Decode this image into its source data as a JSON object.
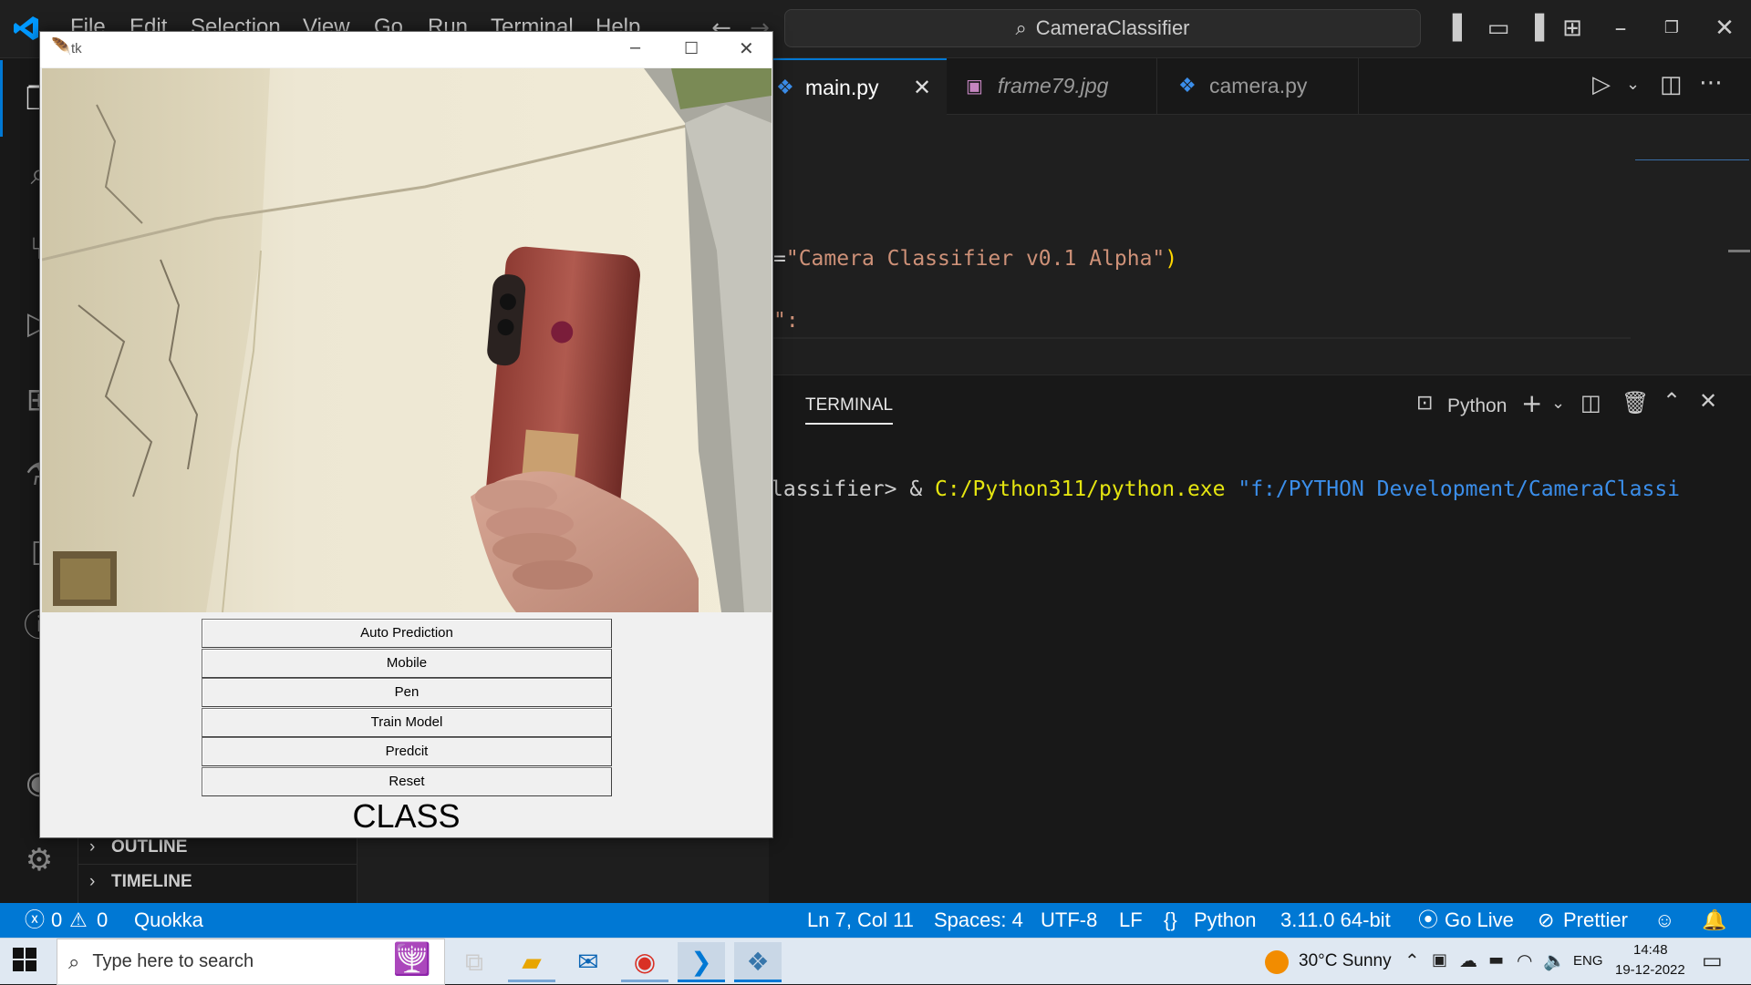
{
  "menu": [
    "File",
    "Edit",
    "Selection",
    "View",
    "Go",
    "Run",
    "Terminal",
    "Help"
  ],
  "command_center": {
    "text": "CameraClassifier",
    "icon": "search-icon"
  },
  "tabs": [
    {
      "label": "main.py",
      "italic": false,
      "active": true,
      "icon": "python-icon"
    },
    {
      "label": "frame79.jpg",
      "italic": true,
      "active": false,
      "icon": "image-icon"
    },
    {
      "label": "camera.py",
      "italic": false,
      "active": false,
      "icon": "python-icon"
    }
  ],
  "editor": {
    "line1_eq": "=",
    "line1_str": "\"Camera Classifier v0.1 Alpha\"",
    "line1_paren": ")",
    "line2": "\":"
  },
  "panel": {
    "tab": "TERMINAL",
    "shell": "Python",
    "term_prefix": "lassifier> & ",
    "term_exe": "C:/Python311/python.exe",
    "term_arg": " \"f:/PYTHON Development/CameraClassi"
  },
  "sidebar": {
    "outline": "OUTLINE",
    "timeline": "TIMELINE"
  },
  "status": {
    "errors": "0",
    "warnings": "0",
    "quokka": "Quokka",
    "position": "Ln 7, Col 11",
    "spaces": "Spaces: 4",
    "encoding": "UTF-8",
    "eol": "LF",
    "language": "Python",
    "interpreter": "3.11.0 64-bit",
    "golive": "Go Live",
    "prettier": "Prettier"
  },
  "taskbar": {
    "search_placeholder": "Type here to search",
    "weather": "30°C  Sunny",
    "lang": "ENG",
    "time": "14:48",
    "date": "19-12-2022"
  },
  "tk": {
    "title": "tk",
    "buttons": [
      "Auto Prediction",
      "Mobile",
      "Pen",
      "Train Model",
      "Predcit",
      "Reset"
    ],
    "class_label": "CLASS"
  },
  "colors": {
    "accent": "#0078d4",
    "string": "#ce9178",
    "exe_yellow": "#e5e510",
    "arg_blue": "#3b8eea"
  }
}
